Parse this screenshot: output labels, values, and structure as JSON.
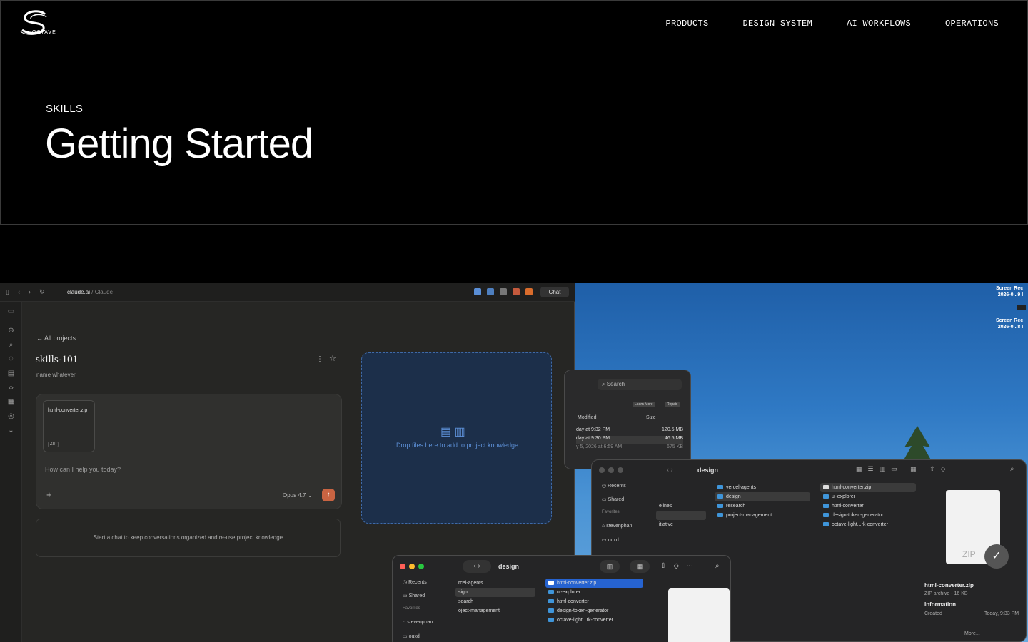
{
  "brand": {
    "logo_text": "OCTAVE"
  },
  "nav": {
    "items": [
      "PRODUCTS",
      "DESIGN SYSTEM",
      "AI WORKFLOWS",
      "OPERATIONS"
    ]
  },
  "hero": {
    "eyebrow": "SKILLS",
    "title": "Getting Started"
  },
  "claude": {
    "url_host": "claude.ai",
    "url_path": " / Claude",
    "chat_button": "Chat",
    "back_link": "← All projects",
    "project_title": "skills-101",
    "project_subtitle": "name whatever",
    "file_name": "html-converter.zip",
    "file_tag": "ZIP",
    "composer_placeholder": "How can I help you today?",
    "model": "Opus 4.7",
    "empty_hint": "Start a chat to keep conversations organized and re-use project knowledge.",
    "dropzone_text": "Drop files here to add to project knowledge"
  },
  "finder_back": {
    "search_placeholder": "Search",
    "learn_more": "Learn More",
    "repair": "Repair",
    "col_modified": "Modified",
    "col_size": "Size",
    "rows": [
      {
        "date": "day at 9:32 PM",
        "size": "120.5 MB"
      },
      {
        "date": "day at 9:30 PM",
        "size": "46.5 MB"
      },
      {
        "date": "y 5, 2026 at 6:59 AM",
        "size": "675 KB"
      }
    ]
  },
  "finder_mid": {
    "title": "design",
    "sidebar": [
      "Recents",
      "Shared"
    ],
    "favorites_label": "Favorites",
    "favorites": [
      "stevenphan",
      "ouxd"
    ],
    "partial_col": [
      "elines",
      "",
      "itiative"
    ],
    "col1": [
      "vercel-agents",
      "design",
      "research",
      "project-management"
    ],
    "col2": [
      "html-converter.zip",
      "ui-explorer",
      "html-converter",
      "design-token-generator",
      "octave-light...rk-converter"
    ],
    "preview_label": "ZIP",
    "info_name": "html-converter.zip",
    "info_meta": "ZIP archive - 16 KB",
    "info_section": "Information",
    "info_created_label": "Created",
    "info_created_value": "Today, 9:33 PM",
    "more": "More..."
  },
  "finder_front": {
    "title": "design",
    "sidebar": [
      "Recents",
      "Shared"
    ],
    "favorites_label": "Favorites",
    "favorites": [
      "stevenphan",
      "ouxd"
    ],
    "col1": [
      "rcel-agents",
      "sign",
      "search",
      "oject-management"
    ],
    "col2": [
      "html-converter.zip",
      "ui-explorer",
      "html-converter",
      "design-token-generator",
      "octave-light...rk-converter"
    ]
  },
  "desktop": {
    "label1a": "Screen Rec",
    "label1b": "2026-0...9 I",
    "label2a": "Screen Rec",
    "label2b": "2026-0...8 I"
  },
  "colors": {
    "accent_send": "#c96442",
    "drop_blue": "#5c8fd6",
    "finder_select": "#2663d0"
  }
}
